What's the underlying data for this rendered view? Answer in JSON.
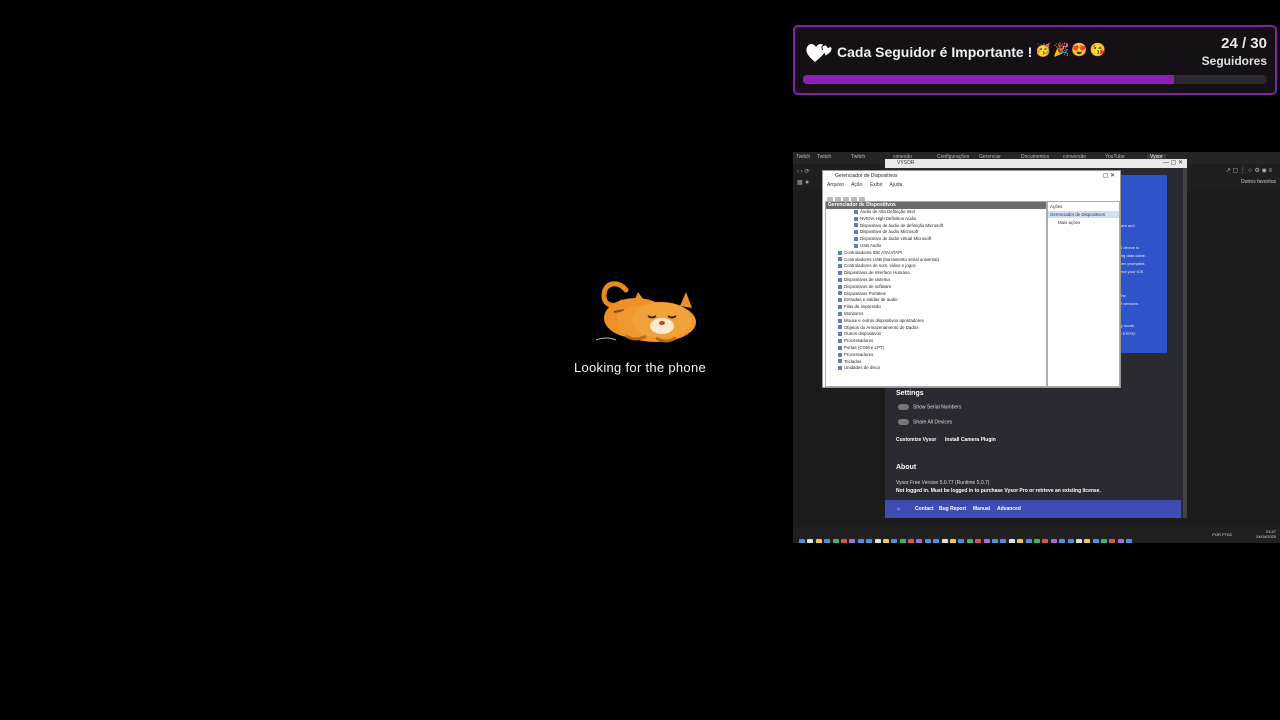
{
  "goal": {
    "title": "Cada Seguidor é Importante !",
    "emojis": "🥳🎉😍😘",
    "count": "24 / 30",
    "unit": "Seguidores",
    "progress": 0.8,
    "accent": "#8c1fb7"
  },
  "status_text": "Looking for the phone",
  "vysor": {
    "title": "VYSOR",
    "settings_title": "Settings",
    "toggles": [
      "Show Serial Numbers",
      "Share All Devices"
    ],
    "links": [
      "Customize Vysor",
      "Install Camera Plugin"
    ],
    "about_title": "About",
    "about_lines": [
      "Vysor Free Version 5.0.77 (Runtime 5.0.7)",
      "Not logged in. Must be logged in to purchase Vysor Pro or retrieve an existing license."
    ],
    "footer": [
      "Contact",
      "Bug Report",
      "Manual",
      "Advanced"
    ],
    "blue_panel_lines": [
      "App Store and",
      "ios.",
      "the iOS device is",
      "Lightning data cable.",
      "iOS when prompted.",
      "reconnect your iOS",
      "mac.",
      "install the",
      "ers and services",
      "",
      "ing only mode.",
      "ows for ESP32"
    ]
  },
  "devmgr": {
    "title": "Gerenciador de Dispositivos",
    "menu": [
      "Arquivo",
      "Ação",
      "Exibir",
      "Ajuda"
    ],
    "tree_header": "Gerenciador de Dispositivos",
    "rows": [
      "  Áudio de Alta Definição Intel",
      "  NVIDIA High Definition Audio",
      "  Dispositivo de áudio de definição Microsoft",
      "  Dispositivo de áudio Microsoft",
      "  Dispositivo de áudio virtual Microsoft",
      "  USB Audio",
      "Controladores IDE ATA/ATAPI",
      "Controladores USB (barramento serial universal)",
      "Controladores de som, vídeo e jogos",
      "Dispositivos de Interface Humana",
      "Dispositivos de sistema",
      "Dispositivos de software",
      "Dispositivos Portáteis",
      "Entradas e saídas de áudio",
      "Filas de impressão",
      "Monitores",
      "Mouse e outros dispositivos apontadores",
      "Objetos do Armazenamento de Dados",
      "Outros dispositivos",
      "Processadores",
      "Portas (COM e LPT)",
      "Processadores",
      "Teclados",
      "Unidades de disco"
    ],
    "side_header": "Ações",
    "side_selected": "Gerenciador de Dispositivos",
    "side_item": "Mais ações"
  },
  "browser": {
    "tabs": [
      "Twitch",
      "Twitch",
      "Twitch",
      "conexão",
      "Configurações",
      "Gerenciar",
      "Documentos",
      "conversão",
      "YouTube",
      "Vysor"
    ],
    "right_label": "Outros favoritos"
  },
  "taskbar": {
    "time": "21:47",
    "date": "24/04/2025",
    "lang": "POR PTB2"
  }
}
